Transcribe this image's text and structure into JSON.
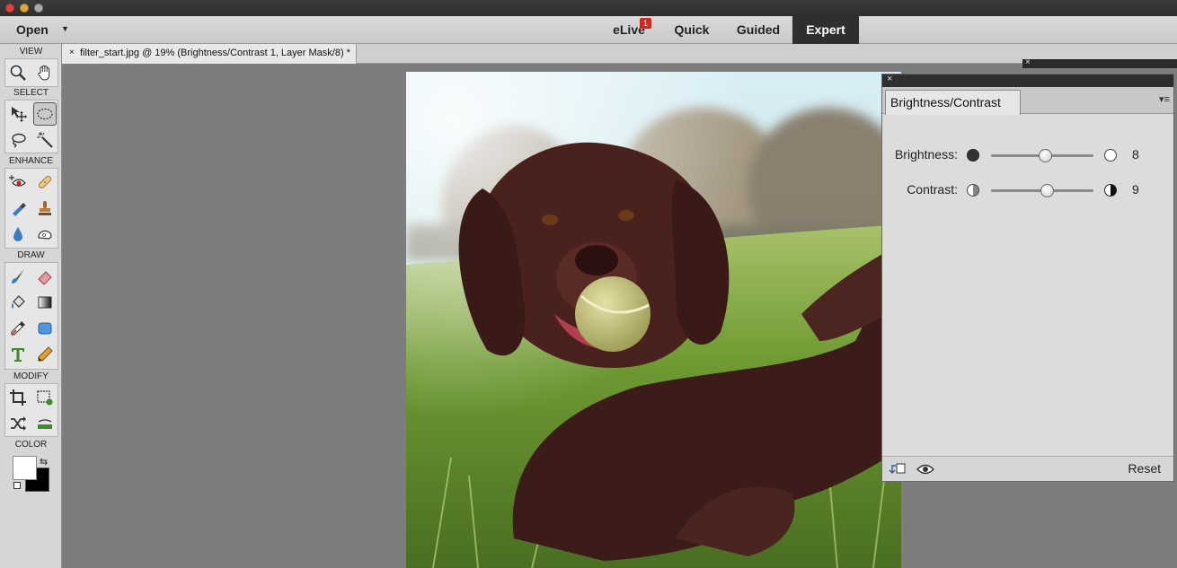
{
  "menubar": {
    "open_label": "Open",
    "modes": [
      {
        "label": "eLive",
        "badge": "1"
      },
      {
        "label": "Quick"
      },
      {
        "label": "Guided"
      },
      {
        "label": "Expert",
        "active": true
      }
    ]
  },
  "tools": {
    "sections": {
      "view": "VIEW",
      "select": "SELECT",
      "enhance": "ENHANCE",
      "draw": "DRAW",
      "modify": "MODIFY",
      "color": "COLOR"
    },
    "items": [
      "zoom-tool",
      "hand-tool",
      "move-tool",
      "marquee-tool",
      "lasso-tool",
      "magic-wand-tool",
      "red-eye-tool",
      "spot-healing-tool",
      "smart-brush-tool",
      "clone-stamp-tool",
      "blur-tool",
      "sponge-tool",
      "brush-tool",
      "eraser-tool",
      "paint-bucket-tool",
      "gradient-tool",
      "eyedropper-tool",
      "shape-tool",
      "type-tool",
      "pencil-tool",
      "crop-tool",
      "recompose-tool",
      "content-aware-move-tool",
      "straighten-tool"
    ],
    "selected": "marquee-tool",
    "foreground_color": "#ffffff",
    "background_color": "#000000"
  },
  "document": {
    "tab_close": "×",
    "tab_title": "filter_start.jpg @ 19% (Brightness/Contrast 1, Layer Mask/8) *"
  },
  "adjustments": {
    "close": "×",
    "tab_title": "Brightness/Contrast",
    "sliders": [
      {
        "label": "Brightness:",
        "value": "8",
        "position": 0.53
      },
      {
        "label": "Contrast:",
        "value": "9",
        "position": 0.55
      }
    ],
    "reset_label": "Reset"
  },
  "colors": {
    "expert_tab_bg": "#2f2f2f",
    "badge": "#d0281d"
  }
}
